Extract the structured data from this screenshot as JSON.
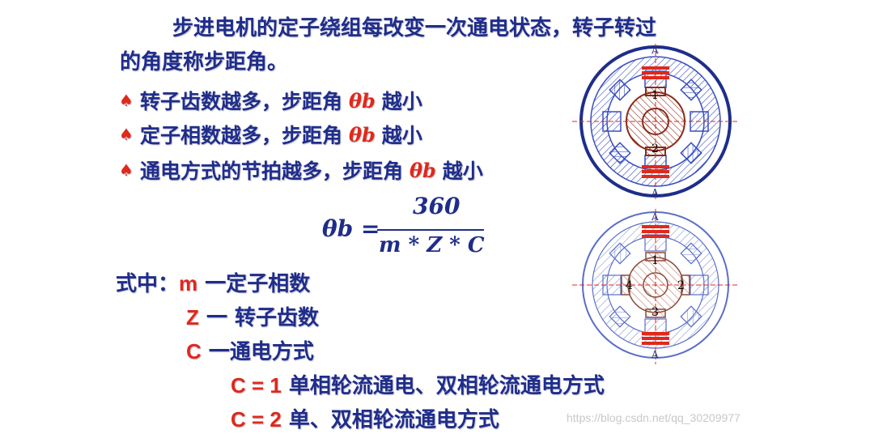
{
  "intro": {
    "line1": "步进电机的定子绕组每改变一次通电状态，转子转过",
    "line2": "的角度称步距角。"
  },
  "bullets": [
    {
      "pre": "转子齿数越多，步距角",
      "theta": "θb",
      "post": "越小"
    },
    {
      "pre": "定子相数越多，步距角",
      "theta": "θb",
      "post": "越小"
    },
    {
      "pre": "通电方式的节拍越多，步距角",
      "theta": "θb",
      "post": " 越小"
    }
  ],
  "formula": {
    "lhs": "θb =",
    "numerator": "360",
    "denominator": "m * Z * C"
  },
  "definitions": {
    "prefix": "式中：",
    "m": {
      "symbol": "m",
      "text": " 一定子相数"
    },
    "z": {
      "symbol": "Z",
      "text": " 一 转子齿数"
    },
    "c": {
      "symbol": "C",
      "text": " 一通电方式"
    },
    "c1": {
      "symbol": "C = 1",
      "text": "  单相轮流通电、双相轮流通电方式"
    },
    "c2": {
      "symbol": "C = 2",
      "text": "  单、双相轮流通电方式"
    }
  },
  "diagrams": {
    "top": {
      "pole_top": "A",
      "pole_bottom": "A",
      "teeth": [
        "1",
        "2"
      ]
    },
    "bottom": {
      "pole_top": "A",
      "pole_bottom": "A",
      "teeth": [
        "1",
        "2",
        "3",
        "4"
      ]
    }
  },
  "watermark": "https://blog.csdn.net/qq_30209977",
  "colors": {
    "text": "#1f2d8a",
    "accent": "#e0291a",
    "stator": "#3a4fc0",
    "rotor": "#8b2a1a"
  }
}
